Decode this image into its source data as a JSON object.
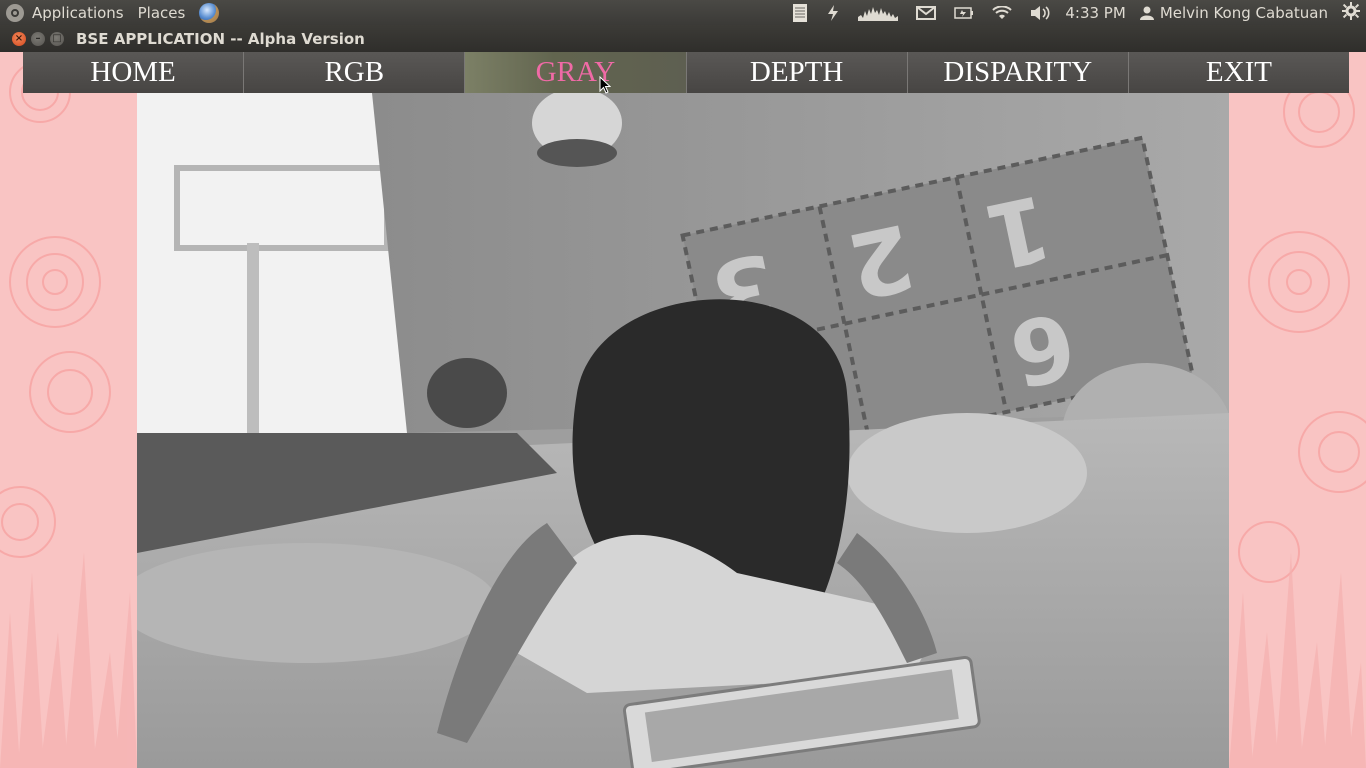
{
  "top_panel": {
    "applications": "Applications",
    "places": "Places",
    "time": "4:33 PM",
    "user": "Melvin Kong Cabatuan",
    "icons": [
      "ubuntu-logo-icon",
      "browser-globe-icon",
      "document-icon",
      "power-icon",
      "network-graph-icon",
      "mail-icon",
      "battery-icon",
      "wifi-icon",
      "volume-icon",
      "user-icon",
      "gear-icon"
    ]
  },
  "window": {
    "title": "BSE APPLICATION -- Alpha Version",
    "close_glyph": "×",
    "minimize_glyph": "–",
    "maximize_glyph": "□"
  },
  "nav": {
    "home": "HOME",
    "rgb": "RGB",
    "gray": "GRAY",
    "depth": "DEPTH",
    "disparity": "DISPARITY",
    "exit": "EXIT",
    "active": "GRAY"
  },
  "colors": {
    "active_tab": "#f06aa6",
    "side_background": "#f9c4c3",
    "nav_background": "#4d4b49"
  }
}
